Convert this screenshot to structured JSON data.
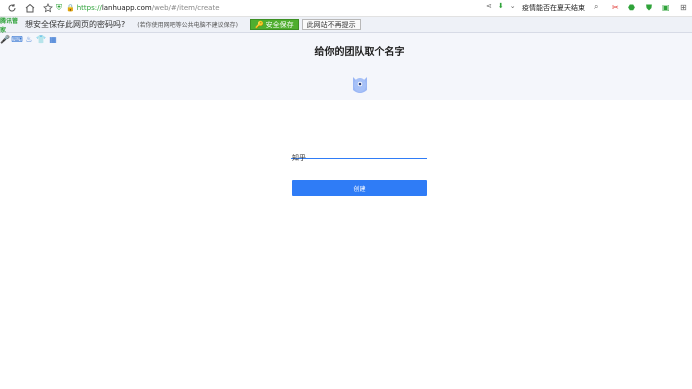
{
  "browser": {
    "url_scheme": "https://",
    "url_host": "lanhuapp.com",
    "url_path": "/web/#/item/create",
    "news_text": "疫情能否在夏天结束"
  },
  "password_bar": {
    "brand": "腾讯管家",
    "question": "想安全保存此网页的密码吗?",
    "hint": "(若你使用网吧等公共电脑不建议保存)",
    "save_label": "安全保存",
    "never_label": "此网站不再提示"
  },
  "page": {
    "title": "给你的团队取个名字",
    "team_name_value": "知乎",
    "create_label": "创建"
  },
  "colors": {
    "accent": "#2f7cf6",
    "save_green": "#4fae2f",
    "header_band": "#f4f6fb"
  }
}
